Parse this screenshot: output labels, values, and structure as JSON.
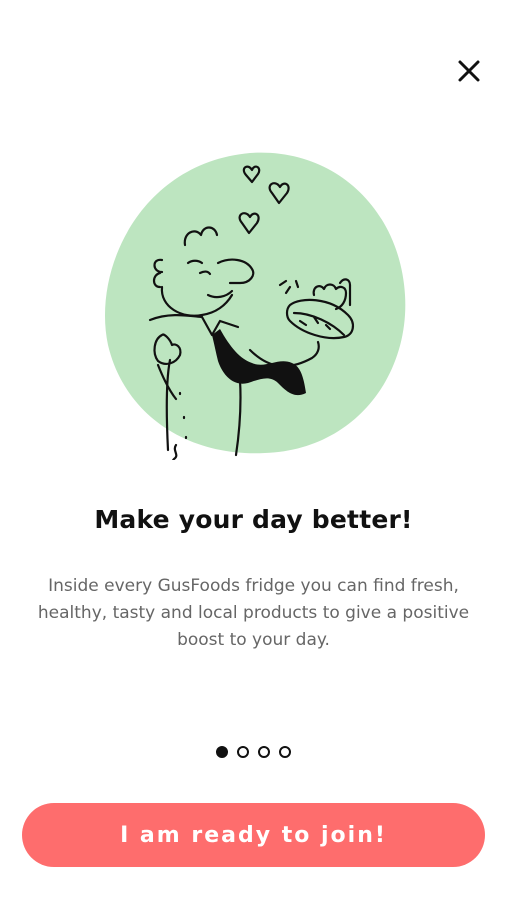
{
  "header": {
    "close_icon": "close-icon"
  },
  "illustration": {
    "icon": "person-eating-sandwich-illustration",
    "blob_color": "#bde5c0"
  },
  "onboarding": {
    "title": "Make your day better!",
    "description": "Inside every GusFoods fridge you can find fresh, healthy, tasty and local products to give a positive boost to your day.",
    "page_count": 4,
    "current_page": 1
  },
  "cta": {
    "label": "I am ready to join!",
    "color": "#fe6d6d"
  }
}
